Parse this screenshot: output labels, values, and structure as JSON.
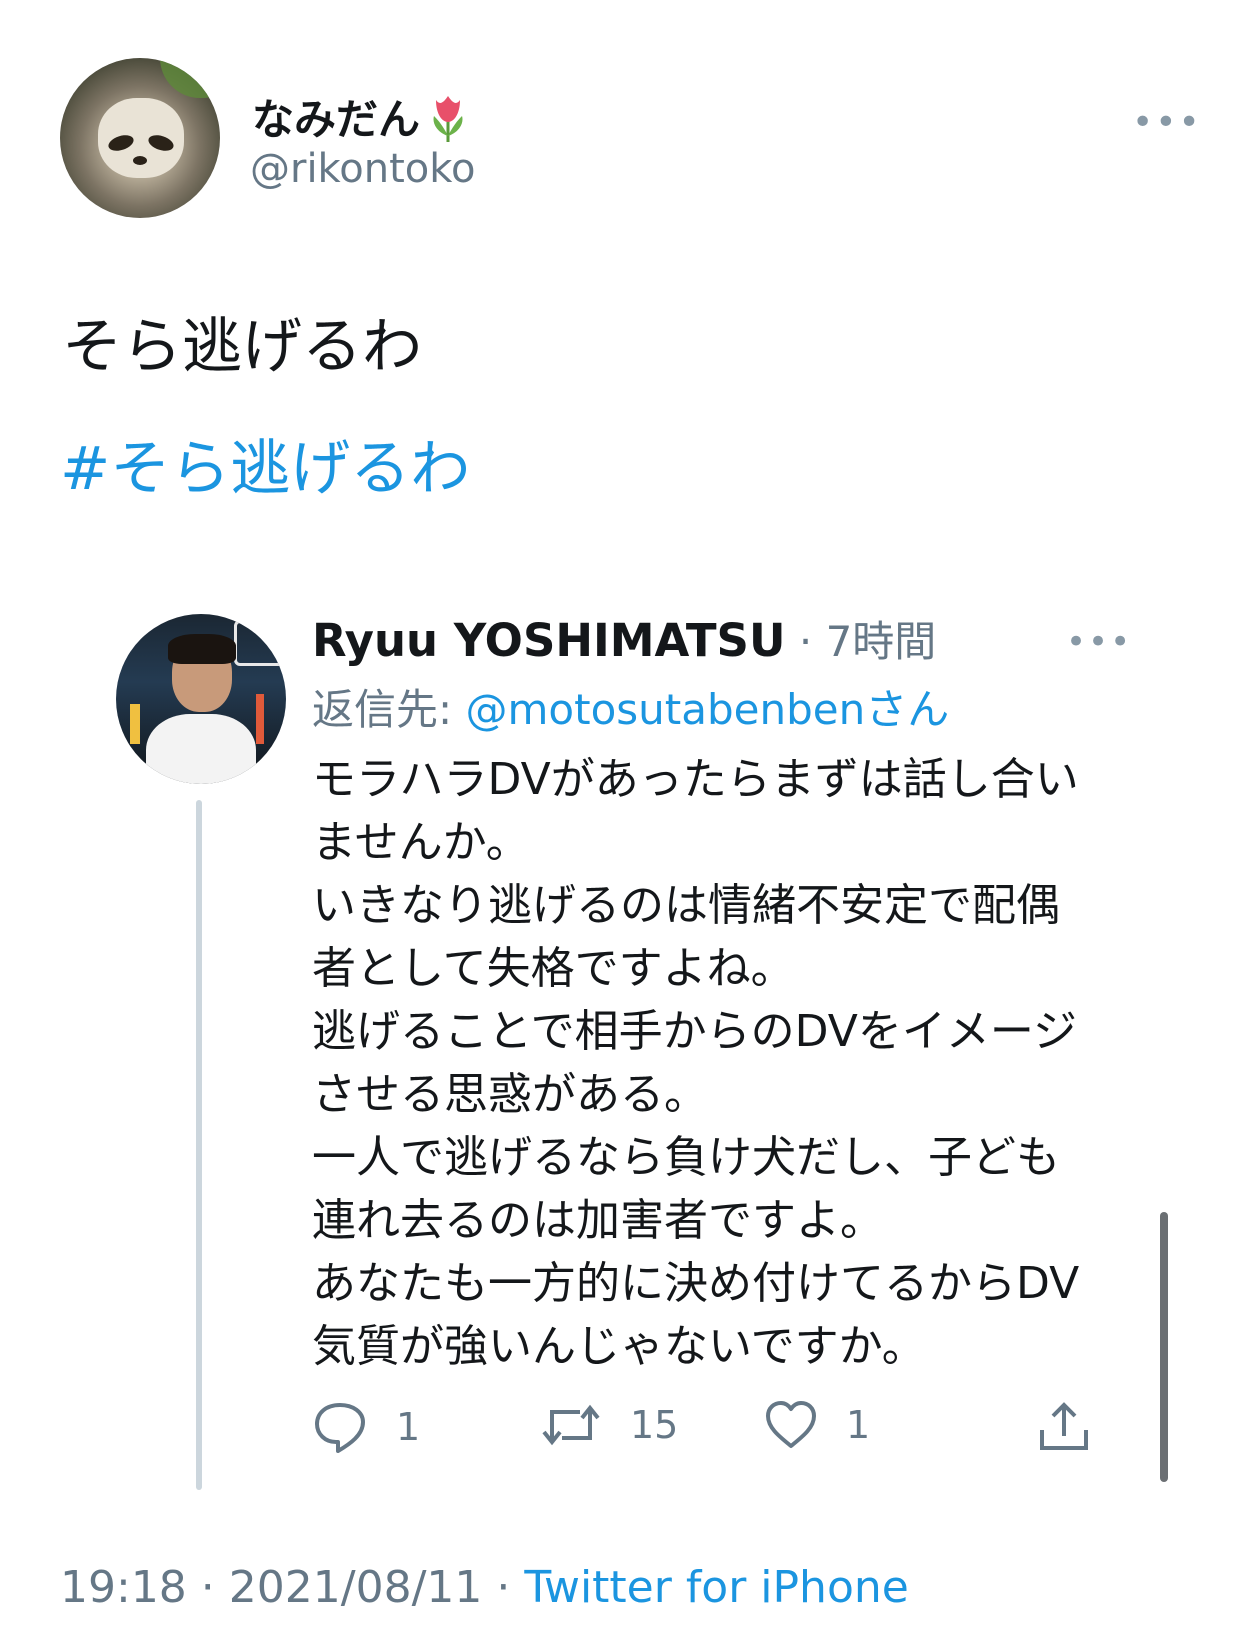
{
  "tweet": {
    "display_name": "なみだん",
    "handle": "@rikontoko",
    "more_label": "•••",
    "text": "そら逃げるわ",
    "hashtag": "#そら逃げるわ",
    "footer": {
      "time": "19:18",
      "sep1": " · ",
      "date": "2021/08/11",
      "sep2": " · ",
      "source": "Twitter for iPhone"
    }
  },
  "reply": {
    "name": "Ryuu YOSHIMATSU",
    "time": " · 7時間",
    "more_label": "•••",
    "reply_to_label": "返信先: ",
    "reply_to_handle": "@motosutabenbenさん",
    "body_lines": [
      "モラハラDVがあったらまずは話し合い",
      "ませんか。",
      "いきなり逃げるのは情緒不安定で配偶",
      "者として失格ですよね。",
      "逃げることで相手からのDVをイメージ",
      "させる思惑がある。",
      "一人で逃げるなら負け犬だし、子ども",
      "連れ去るのは加害者ですよ。",
      "あなたも一方的に決め付けてるからDV",
      "気質が強いんじゃないですか。"
    ],
    "actions": {
      "reply_count": "1",
      "retweet_count": "15",
      "like_count": "1"
    }
  },
  "colors": {
    "link": "#1b95e0",
    "secondary": "#657786",
    "text": "#14171a"
  }
}
